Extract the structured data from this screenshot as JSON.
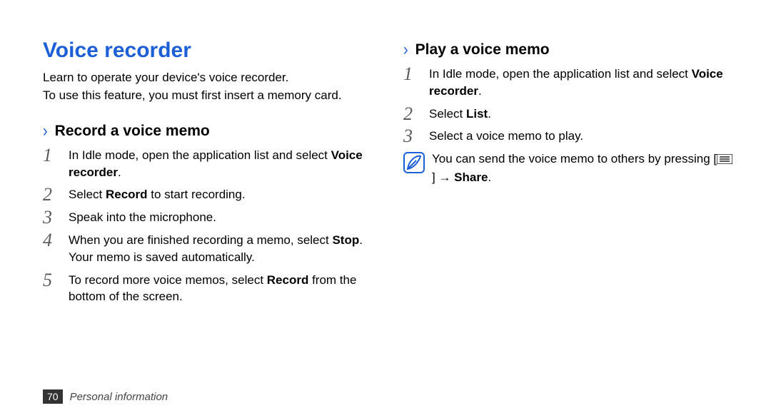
{
  "title": "Voice recorder",
  "intro": [
    "Learn to operate your device's voice recorder.",
    "To use this feature, you must first insert a memory card."
  ],
  "section_record": {
    "heading": "Record a voice memo",
    "steps": [
      {
        "pre": "In Idle mode, open the application list and select ",
        "bold": "Voice recorder",
        "post": "."
      },
      {
        "pre": "Select ",
        "bold": "Record",
        "post": " to start recording."
      },
      {
        "pre": "Speak into the microphone.",
        "bold": "",
        "post": ""
      },
      {
        "pre": "When you are finished recording a memo, select ",
        "bold": "Stop",
        "post": ". Your memo is saved automatically."
      },
      {
        "pre": "To record more voice memos, select ",
        "bold": "Record",
        "post": " from the bottom of the screen."
      }
    ]
  },
  "section_play": {
    "heading": "Play a voice memo",
    "steps": [
      {
        "pre": "In Idle mode, open the application list and select ",
        "bold": "Voice recorder",
        "post": "."
      },
      {
        "pre": "Select ",
        "bold": "List",
        "post": "."
      },
      {
        "pre": "Select a voice memo to play.",
        "bold": "",
        "post": ""
      }
    ],
    "note": {
      "pre": "You can send the voice memo to others by pressing [",
      "mid": "] → ",
      "bold": "Share",
      "post": "."
    }
  },
  "footer": {
    "page": "70",
    "section": "Personal information"
  }
}
